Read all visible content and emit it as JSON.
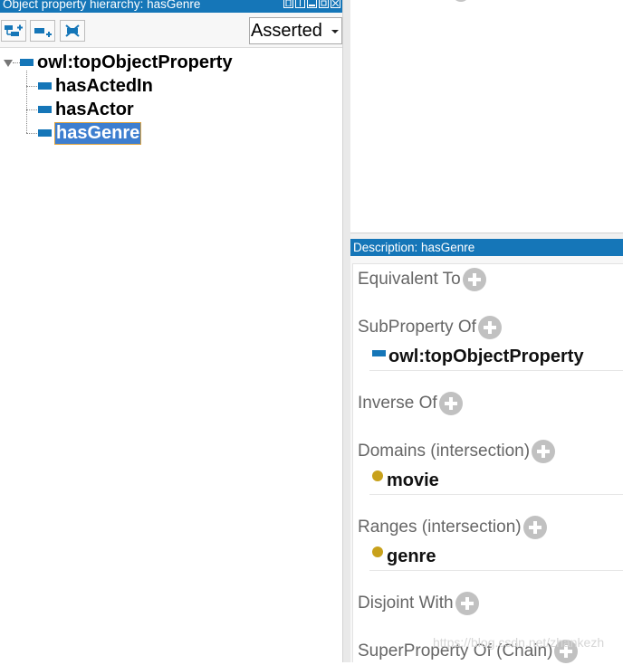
{
  "left_panel": {
    "title": "Object property hierarchy: hasGenre",
    "toolbar": {
      "buttons": [
        {
          "icon": "add-subproperty-icon"
        },
        {
          "icon": "add-sibling-property-icon"
        },
        {
          "icon": "delete-property-icon"
        }
      ],
      "view_mode": "Asserted"
    },
    "tree": {
      "root": "owl:topObjectProperty",
      "children": [
        "hasActedIn",
        "hasActor",
        "hasGenre"
      ],
      "selected": "hasGenre"
    }
  },
  "description": {
    "title": "Description: hasGenre",
    "sections": {
      "equivalent_to": "Equivalent To",
      "subproperty_of": "SubProperty Of",
      "inverse_of": "Inverse Of",
      "domains": "Domains (intersection)",
      "ranges": "Ranges (intersection)",
      "disjoint_with": "Disjoint With",
      "superproperty_chain": "SuperProperty Of (Chain)"
    },
    "entries": {
      "subproperty_of": "owl:topObjectProperty",
      "domain": "movie",
      "range": "genre"
    }
  },
  "watermark": "https://blog.csdn.net/zhankezh",
  "colors": {
    "title_bar": "#1576b8",
    "property_icon": "#1576b8",
    "class_icon": "#c8a11b",
    "selection": "#3d7ecf"
  }
}
